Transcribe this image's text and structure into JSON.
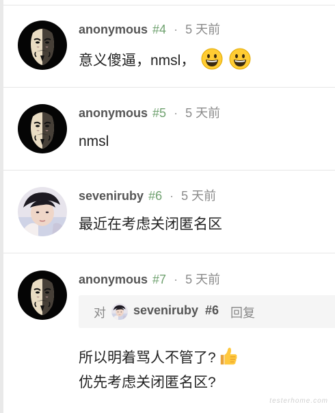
{
  "replies": [
    {
      "author": "anonymous",
      "floor": "#4",
      "separator": "·",
      "time": "5 天前",
      "avatar": "guy-fawkes-mask-avatar",
      "body": "意义傻逼，nmsl，",
      "emojis": [
        "grinning-face-emoji",
        "grinning-face-emoji"
      ]
    },
    {
      "author": "anonymous",
      "floor": "#5",
      "separator": "·",
      "time": "5 天前",
      "avatar": "guy-fawkes-mask-avatar",
      "body": "nmsl"
    },
    {
      "author": "seveniruby",
      "floor": "#6",
      "separator": "·",
      "time": "5 天前",
      "avatar": "user-photo-avatar",
      "body": "最近在考虑关闭匿名区"
    },
    {
      "author": "anonymous",
      "floor": "#7",
      "separator": "·",
      "time": "5 天前",
      "avatar": "guy-fawkes-mask-avatar",
      "quote": {
        "prefix": "对",
        "author": "seveniruby",
        "floor": "#6",
        "label": "回复"
      },
      "body_lines": [
        "所以明着骂人不管了?",
        "优先考虑关闭匿名区?"
      ],
      "emoji": "thumbs-up-emoji"
    }
  ],
  "watermark": "testerhome.com",
  "colors": {
    "floor": "#6fa16f",
    "author": "#555555",
    "time": "#8a8a8a",
    "quote_bg": "#f5f5f5"
  }
}
